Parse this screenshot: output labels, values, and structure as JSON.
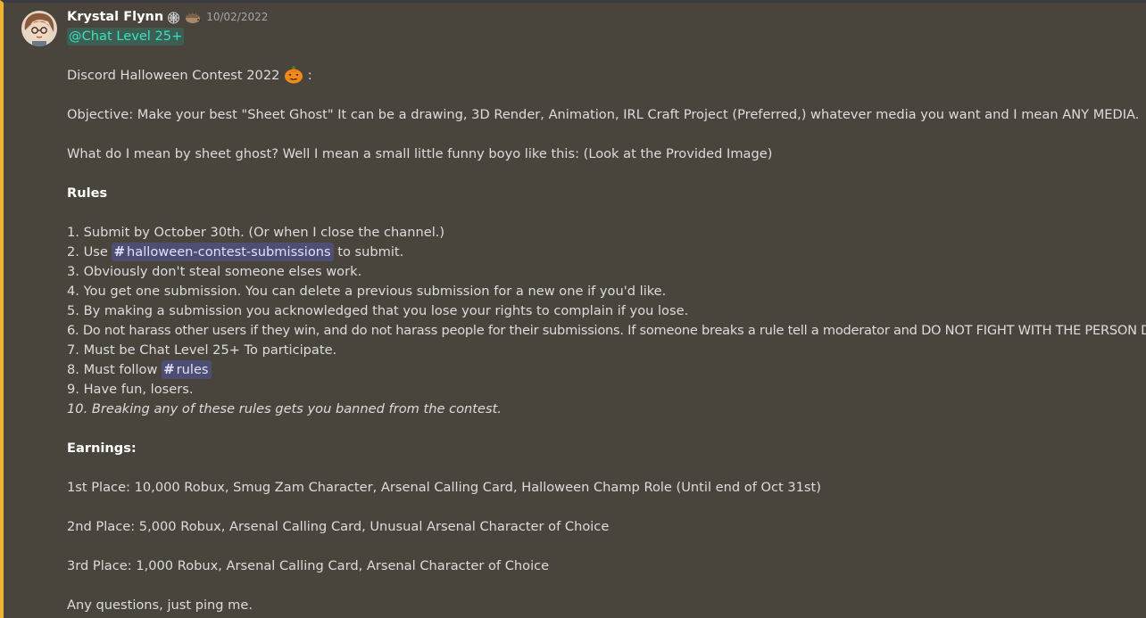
{
  "author": {
    "name": "Krystal Flynn",
    "badges": [
      "cobweb-icon",
      "hedgehog-icon"
    ],
    "timestamp": "10/02/2022"
  },
  "role_mention": "@Chat Level 25+",
  "title_line": {
    "text": "Discord Halloween Contest 2022",
    "emoji": "jack-o-lantern-icon",
    "suffix": ":"
  },
  "objective": "Objective: Make your best \"Sheet Ghost\" It can be a drawing, 3D Render, Animation, IRL Craft Project (Preferred,) whatever media you want and I mean ANY MEDIA.",
  "explanation": "What do I mean by sheet ghost? Well I mean a small little funny boyo like this: (Look at the Provided Image)",
  "rules_heading": "Rules",
  "rules": {
    "r1": "1. Submit by October 30th. (Or when I close the channel.)",
    "r2_prefix": "2. Use ",
    "r2_channel": "halloween-contest-submissions",
    "r2_suffix": " to submit.",
    "r3": "3. Obviously don't steal someone elses work.",
    "r4": "4. You get one submission. You can delete a previous submission for a new one if you'd like.",
    "r5": "5. By making a submission you acknowledged that you lose your rights to complain if you lose.",
    "r6": "6. Do not harass other users if they win, and do not harass people for their submissions. If someone breaks a rule tell a moderator and DO NOT FIGHT WITH THE PERSON DANG IT!",
    "r7": "7. Must be Chat Level 25+ To participate.",
    "r8_prefix": "8. Must follow ",
    "r8_channel": "rules",
    "r9": "9. Have fun, losers.",
    "r10": "10. Breaking any of these rules gets you banned from the contest."
  },
  "channel_hash": "#",
  "earnings_heading": "Earnings:",
  "earnings": {
    "first": "1st Place: 10,000 Robux, Smug Zam Character, Arsenal Calling Card, Halloween Champ Role (Until end of Oct 31st)",
    "second": "2nd Place: 5,000 Robux, Arsenal Calling Card, Unusual Arsenal Character of Choice",
    "third": "3rd Place: 1,000 Robux, Arsenal Calling Card, Arsenal Character of Choice"
  },
  "closing": "Any questions, just ping me.",
  "colors": {
    "highlight_bg": "#49443c",
    "highlight_border": "#f0b232",
    "role_color": "#3ce0bf",
    "channel_mention": "#5865f2"
  }
}
